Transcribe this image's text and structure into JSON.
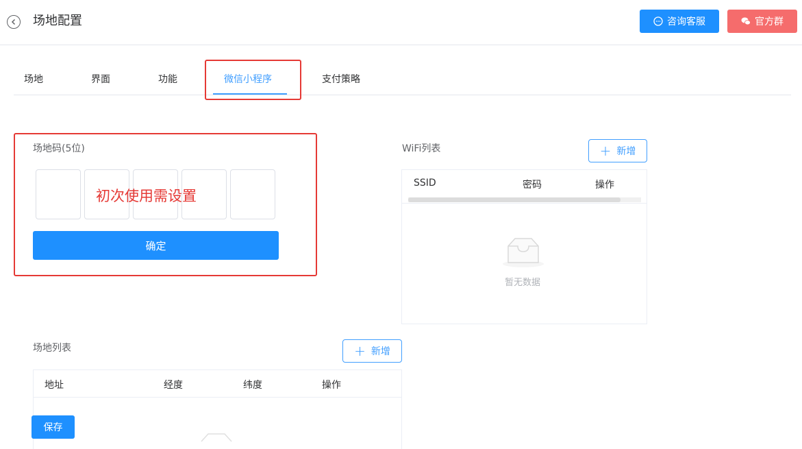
{
  "header": {
    "title": "场地配置",
    "consult_label": "咨询客服",
    "group_label": "官方群"
  },
  "tabs": [
    {
      "label": "场地",
      "active": false
    },
    {
      "label": "界面",
      "active": false
    },
    {
      "label": "功能",
      "active": false
    },
    {
      "label": "微信小程序",
      "active": true
    },
    {
      "label": "支付策略",
      "active": false
    }
  ],
  "venue_code": {
    "label": "场地码(5位)",
    "hint": "初次使用需设置",
    "confirm_label": "确定"
  },
  "wifi": {
    "title": "WiFi列表",
    "add_label": "新增",
    "columns": [
      "SSID",
      "密码",
      "操作"
    ],
    "empty_text": "暂无数据"
  },
  "venue_list": {
    "title": "场地列表",
    "add_label": "新增",
    "columns": [
      "地址",
      "经度",
      "纬度",
      "操作"
    ]
  },
  "save_label": "保存",
  "colors": {
    "primary": "#1e90ff",
    "danger": "#f56c6c",
    "annotation": "#e53935",
    "tab_active": "#409eff"
  }
}
